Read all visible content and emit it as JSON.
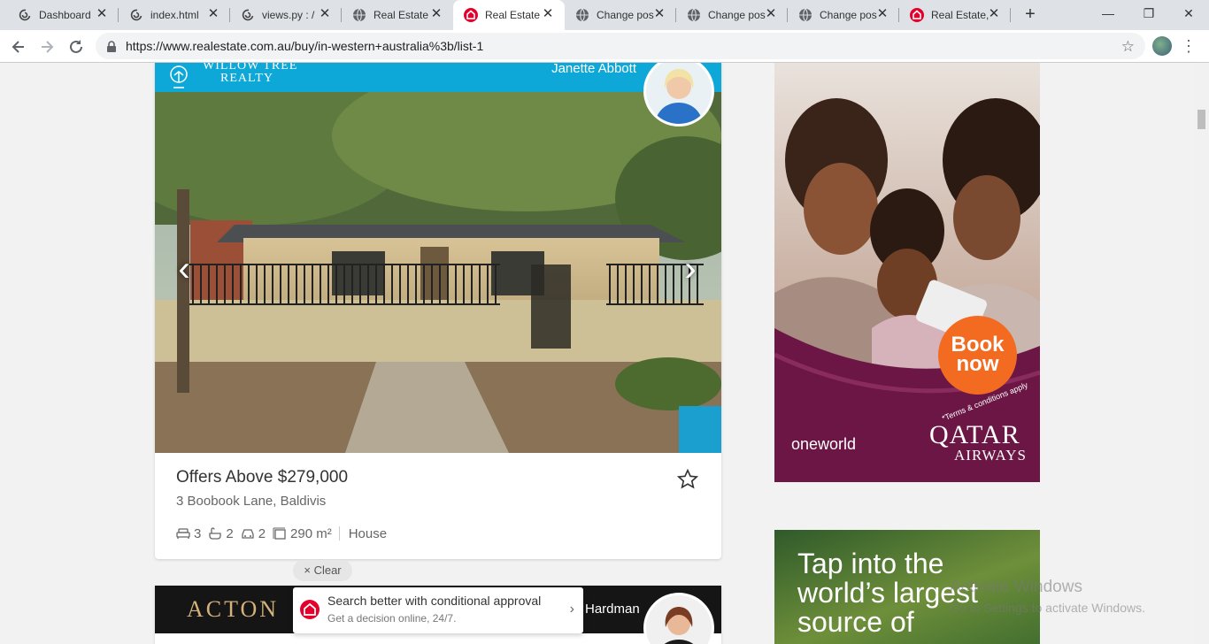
{
  "browser": {
    "tabs": [
      {
        "label": "Dashboard",
        "icon": "spiral-favicon-icon",
        "active": false
      },
      {
        "label": "index.html",
        "icon": "spiral-favicon-icon",
        "active": false
      },
      {
        "label": "views.py : /",
        "icon": "spiral-favicon-icon",
        "active": false
      },
      {
        "label": "Real Estate",
        "icon": "globe-favicon-icon",
        "active": false
      },
      {
        "label": "Real Estate",
        "icon": "realestate-favicon-icon",
        "active": true
      },
      {
        "label": "Change pos",
        "icon": "globe-favicon-icon",
        "active": false
      },
      {
        "label": "Change pos",
        "icon": "globe-favicon-icon",
        "active": false
      },
      {
        "label": "Change pos",
        "icon": "globe-favicon-icon",
        "active": false
      },
      {
        "label": "Real Estate,",
        "icon": "realestate-favicon-icon",
        "active": false
      }
    ],
    "new_tab": "+",
    "close_glyph": "✕",
    "window": {
      "minimize": "—",
      "maximize": "❐",
      "close": "✕"
    },
    "url": "https://www.realestate.com.au/buy/in-western+australia%3b/list-1"
  },
  "listing": {
    "agency": {
      "line1": "WILLOW TREE",
      "line2": "REALTY"
    },
    "agent_name": "Janette Abbott",
    "price": "Offers Above $279,000",
    "address": "3 Boobook Lane, Baldivis",
    "bedrooms": "3",
    "bathrooms": "2",
    "parking": "2",
    "land_size": "290 m²",
    "property_type": "House",
    "colors": {
      "agency_strip": "#0ea8d8"
    }
  },
  "filters": {
    "clear_label": "Clear"
  },
  "listing2": {
    "agency": "ACTON",
    "agent_name": "Hardman"
  },
  "finance_banner": {
    "title": "Search better with conditional approval",
    "subtitle": "Get a decision online, 24/7."
  },
  "ads": {
    "qatar": {
      "cta": "Book now",
      "cta_line1": "Book",
      "cta_line2": "now",
      "terms": "*Terms & conditions apply",
      "alliance": "oneworld",
      "brand_line1": "QATAR",
      "brand_line2": "AIRWAYS",
      "colors": {
        "cta": "#f26b21",
        "panel": "#6b1645"
      }
    },
    "second": {
      "headline_lines": [
        "Tap into the",
        "world’s largest",
        "source of"
      ]
    }
  },
  "watermark": {
    "line1": "Activate Windows",
    "line2": "Go to Settings to activate Windows."
  }
}
